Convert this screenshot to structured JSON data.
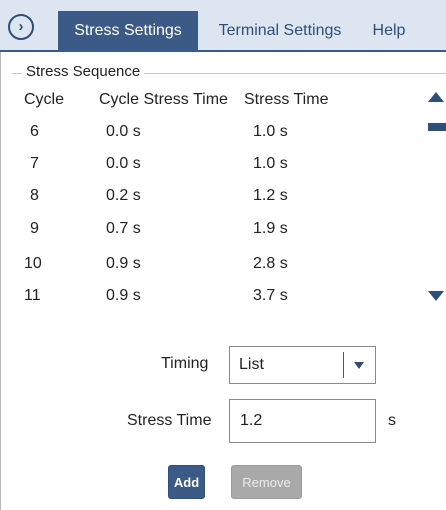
{
  "nav": {
    "icon": "chevron-right-circle-icon",
    "glyph": "›"
  },
  "tabs": [
    {
      "label": "Stress Settings",
      "active": true
    },
    {
      "label": "Terminal Settings",
      "active": false
    },
    {
      "label": "Help",
      "active": false
    }
  ],
  "stress_sequence": {
    "title": "Stress Sequence",
    "columns": [
      "Cycle",
      "Cycle Stress Time",
      "Stress Time"
    ],
    "rows": [
      {
        "cycle": "6",
        "cycle_stress_time": "0.0 s",
        "stress_time": "1.0 s"
      },
      {
        "cycle": "7",
        "cycle_stress_time": "0.0 s",
        "stress_time": "1.0 s"
      },
      {
        "cycle": "8",
        "cycle_stress_time": "0.2 s",
        "stress_time": "1.2 s"
      },
      {
        "cycle": "9",
        "cycle_stress_time": "0.7 s",
        "stress_time": "1.9 s"
      },
      {
        "cycle": "10",
        "cycle_stress_time": "0.9 s",
        "stress_time": "2.8 s"
      },
      {
        "cycle": "11",
        "cycle_stress_time": "0.9 s",
        "stress_time": "3.7 s"
      }
    ]
  },
  "form": {
    "timing_label": "Timing",
    "timing_value": "List",
    "stress_time_label": "Stress Time",
    "stress_time_value": "1.2",
    "stress_time_unit": "s"
  },
  "buttons": {
    "add": "Add",
    "remove": "Remove"
  },
  "colors": {
    "accent": "#3b5a86",
    "tabbar": "#dde6f0",
    "disabled": "#a9a9a9"
  }
}
